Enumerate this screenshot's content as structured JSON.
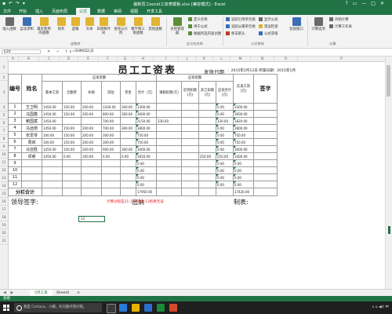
{
  "window": {
    "title": "最新员工excel工资表模板.xlsx [兼容模式] - Excel",
    "controls": [
      "?",
      "▭",
      "—",
      "□",
      "✕"
    ]
  },
  "ribbon_tabs": [
    "文件",
    "开始",
    "插入",
    "页面布局",
    "公式",
    "数据",
    "审阅",
    "视图",
    "开发工具"
  ],
  "active_tab_index": 4,
  "ribbon": {
    "buttons": [
      {
        "label": "插入函数",
        "icon": "function-icon",
        "color": "#6a6a6a"
      },
      {
        "label": "自动求和",
        "icon": "sigma-icon",
        "color": "#3a6fb3"
      },
      {
        "label": "最近使用的函数",
        "icon": "star-icon",
        "color": "#e2b431"
      },
      {
        "label": "财务",
        "icon": "finance-icon",
        "color": "#e2b431"
      },
      {
        "label": "逻辑",
        "icon": "logic-icon",
        "color": "#e2b431"
      },
      {
        "label": "文本",
        "icon": "text-icon",
        "color": "#e2b431"
      },
      {
        "label": "日期和时间",
        "icon": "clock-icon",
        "color": "#e2b431"
      },
      {
        "label": "查找与引用",
        "icon": "search-icon",
        "color": "#e2b431"
      },
      {
        "label": "数学和三角函数",
        "icon": "theta-icon",
        "color": "#e2b431"
      },
      {
        "label": "其他函数",
        "icon": "more-icon",
        "color": "#e2b431"
      },
      {
        "label": "名称管理器",
        "icon": "tag-icon",
        "color": "#5a8f3a"
      },
      {
        "label": "监视窗口",
        "icon": "watch-icon",
        "color": "#3a6fb3"
      },
      {
        "label": "计算选项",
        "icon": "calc-icon",
        "color": "#6a6a6a"
      }
    ],
    "small_buttons": [
      {
        "label": "定义名称",
        "icon": "define-name-icon"
      },
      {
        "label": "用于公式",
        "icon": "use-formula-icon"
      },
      {
        "label": "根据所选内容创建",
        "icon": "create-from-icon"
      },
      {
        "label": "追踪引用单元格",
        "icon": "trace-precedents-icon"
      },
      {
        "label": "追踪从属单元格",
        "icon": "trace-dependents-icon"
      },
      {
        "label": "移去箭头",
        "icon": "remove-arrows-icon"
      },
      {
        "label": "显示公式",
        "icon": "show-formulas-icon"
      },
      {
        "label": "错误检查",
        "icon": "error-check-icon"
      },
      {
        "label": "公式求值",
        "icon": "evaluate-icon"
      },
      {
        "label": "开始计算",
        "icon": "calc-now-icon"
      },
      {
        "label": "计算工作表",
        "icon": "calc-sheet-icon"
      }
    ],
    "group_labels": [
      "函数库",
      "定义的名称",
      "公式审核",
      "计算"
    ]
  },
  "formula_bar": {
    "name_box": "E20",
    "fx_buttons": "✕ ✓ fx",
    "formula": "=SUM(D2:J2"
  },
  "columns": [
    "A",
    "B",
    "C",
    "D",
    "E",
    "F",
    "G",
    "H",
    "I",
    "J",
    "K",
    "L",
    "M",
    "N",
    "O",
    "P"
  ],
  "rows": [
    "1",
    "2",
    "3",
    "4",
    "5",
    "6",
    "7",
    "8",
    "9",
    "10",
    "11",
    "12",
    "13",
    "14",
    "15",
    "16",
    "17",
    "18",
    "19",
    "20",
    "21"
  ],
  "sheet": {
    "title": "员工工资表",
    "issue_date_label": "发放日期",
    "issue_date_value": "：2015年2月12日 所属日期：2015年1月",
    "headers": {
      "serial": "编号",
      "name": "姓名",
      "payable_group": "应发金额",
      "base": "基本工资",
      "bonus": "全勤奖",
      "subsidy": "补助",
      "position": "岗位",
      "award": "奖金",
      "subtotal": "合计（元）",
      "deduct_group": "应扣金额",
      "absence": "请假扣款(元)",
      "late": "迟到扣款(元)",
      "other": "其它扣款(元)",
      "deduct_total": "应扣合计(元)",
      "actual": "实发工资(元)",
      "sign": "签字"
    },
    "rows": [
      {
        "n": "1",
        "name": "王卫明",
        "base": "1450.00",
        "bonus": "150.00",
        "subsidy": "200.00",
        "position": "1200.00",
        "award": "300.00",
        "total": "3300.00",
        "absence": "",
        "late": "",
        "other": "",
        "dtotal": "0.00",
        "actual": "3300.00"
      },
      {
        "n": "2",
        "name": "马国鑫",
        "base": "1450.00",
        "bonus": "150.00",
        "subsidy": "200.00",
        "position": "900.00",
        "award": "300.00",
        "total": "3000.00",
        "absence": "",
        "late": "",
        "other": "",
        "dtotal": "0.00",
        "actual": "3000.00"
      },
      {
        "n": "3",
        "name": "赖国斌",
        "base": "1450.00",
        "bonus": "",
        "subsidy": "",
        "position": "700.00",
        "award": "",
        "total": "2150.00",
        "absence": "330.00",
        "late": "",
        "other": "",
        "dtotal": "330.00",
        "actual": "1820.00"
      },
      {
        "n": "4",
        "name": "马远南",
        "base": "1450.00",
        "bonus": "150.00",
        "subsidy": "200.00",
        "position": "700.00",
        "award": "300.00",
        "total": "2800.00",
        "absence": "",
        "late": "",
        "other": "",
        "dtotal": "0.00",
        "actual": "2800.00"
      },
      {
        "n": "5",
        "name": "张爱琴",
        "base": "100.00",
        "bonus": "150.00",
        "subsidy": "200.00",
        "position": "300.00",
        "award": "",
        "total": "750.00",
        "absence": "",
        "late": "",
        "other": "",
        "dtotal": "0.00",
        "actual": "750.00"
      },
      {
        "n": "6",
        "name": "周四",
        "base": "100.00",
        "bonus": "150.00",
        "subsidy": "200.00",
        "position": "300.00",
        "award": "",
        "total": "750.00",
        "absence": "",
        "late": "",
        "other": "",
        "dtotal": "0.00",
        "actual": "750.00"
      },
      {
        "n": "7",
        "name": "马亚胜",
        "base": "1450.00",
        "bonus": "150.00",
        "subsidy": "200.00",
        "position": "900.00",
        "award": "300.00",
        "total": "3000.00",
        "absence": "",
        "late": "",
        "other": "",
        "dtotal": "0.00",
        "actual": "3000.00"
      },
      {
        "n": "8",
        "name": "邓睿",
        "base": "1450.00",
        "bonus": "0.00",
        "subsidy": "100.00",
        "position": "0.00",
        "award": "0.00",
        "total": "1650.00",
        "absence": "",
        "late": "",
        "other": "250.00",
        "dtotal": "250.00",
        "actual": "1400.00"
      },
      {
        "n": "9",
        "name": "",
        "base": "",
        "bonus": "",
        "subsidy": "",
        "position": "",
        "award": "",
        "total": "0.00",
        "absence": "",
        "late": "",
        "other": "",
        "dtotal": "0.00",
        "actual": "0.00"
      },
      {
        "n": "10",
        "name": "",
        "base": "",
        "bonus": "",
        "subsidy": "",
        "position": "",
        "award": "",
        "total": "0.00",
        "absence": "",
        "late": "",
        "other": "",
        "dtotal": "0.00",
        "actual": "0.00"
      },
      {
        "n": "11",
        "name": "",
        "base": "",
        "bonus": "",
        "subsidy": "",
        "position": "",
        "award": "",
        "total": "0.00",
        "absence": "",
        "late": "",
        "other": "",
        "dtotal": "0.00",
        "actual": "0.00"
      },
      {
        "n": "12",
        "name": "",
        "base": "",
        "bonus": "",
        "subsidy": "",
        "position": "",
        "award": "",
        "total": "0.00",
        "absence": "",
        "late": "",
        "other": "",
        "dtotal": "0.00",
        "actual": "0.00"
      }
    ],
    "subtotal_label": "分栏合计",
    "subtotal_total": "17950.00",
    "subtotal_actual": "17420.00",
    "sig_leader": "领导签字:",
    "sig_cashier": "出纳",
    "sig_maker": "制表:",
    "note": "计算过程是21:13时至1-13结果无误",
    "selected_cell_text": "13"
  },
  "sheet_tabs": [
    "5月工资",
    "Sheet3"
  ],
  "active_sheet_index": 0,
  "status": "就绪",
  "taskbar": {
    "search_placeholder": "我是 Cortana，小娜。有问题尽管问我。",
    "tray_text": "∧ ⌂ ◀)) 中"
  }
}
